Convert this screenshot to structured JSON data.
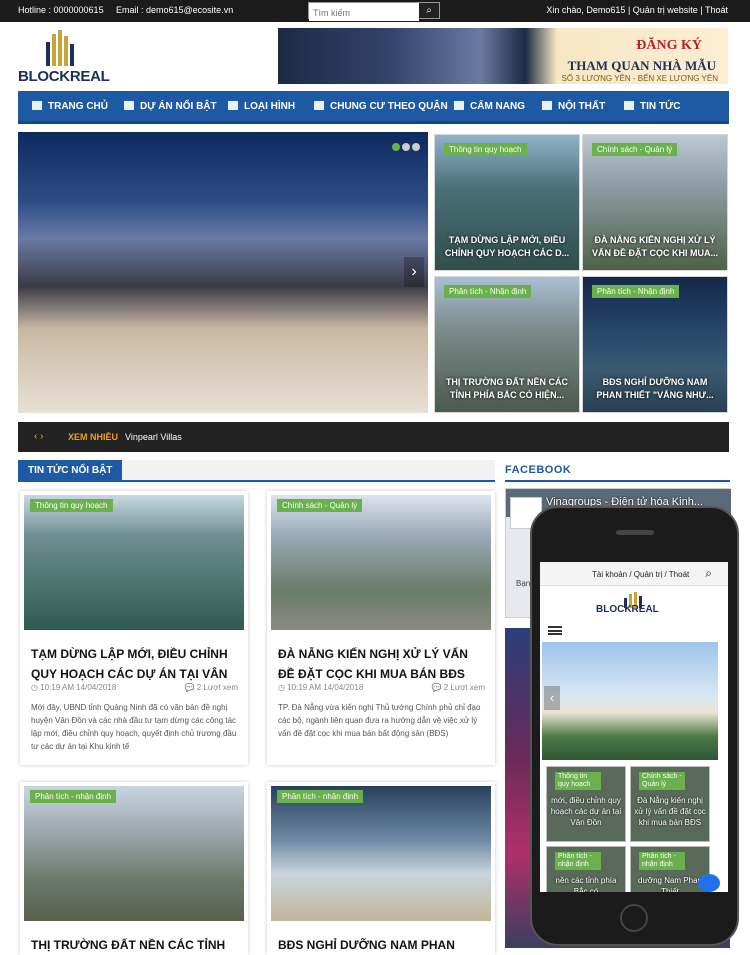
{
  "topbar": {
    "hotline": "Hotline : 0000000615",
    "email": "Email : demo615@ecosite.vn",
    "search_placeholder": "Tìm kiếm",
    "greeting": "Xin chào, Demo615 | Quản trị website | Thoát"
  },
  "logo": {
    "text": "BLOCKREAL"
  },
  "banner": {
    "line1": "ĐĂNG KÝ",
    "line2": "THAM QUAN NHÀ MẪU",
    "line3": "SỐ 3 LƯƠNG YÊN - BẾN XE LƯƠNG YÊN"
  },
  "nav": [
    {
      "label": "TRANG CHỦ",
      "icon": "home-icon"
    },
    {
      "label": "DỰ ÁN NỔI BẬT",
      "icon": "send-icon"
    },
    {
      "label": "LOẠI HÌNH",
      "icon": "image-icon"
    },
    {
      "label": "CHUNG CƯ THEO QUẬN",
      "icon": "briefcase-icon"
    },
    {
      "label": "CẨM NANG",
      "icon": "building-icon"
    },
    {
      "label": "NỘI THẤT",
      "icon": "book-icon"
    },
    {
      "label": "TIN TỨC",
      "icon": "newspaper-icon"
    }
  ],
  "hero_tiles": [
    {
      "tag": "Thông tin quy hoạch",
      "title": "TẠM DỪNG LẬP MỚI, ĐIỀU CHỈNH QUY HOẠCH CÁC D..."
    },
    {
      "tag": "Chính sách - Quản lý",
      "title": "ĐÀ NẴNG KIẾN NGHỊ XỬ LÝ VẤN ĐỀ ĐẶT CỌC KHI MUA..."
    },
    {
      "tag": "Phân tích - Nhận định",
      "title": "THỊ TRƯỜNG ĐẤT NỀN CÁC TỈNH PHÍA BẮC CÓ HIỆN..."
    },
    {
      "tag": "Phân tích - Nhận định",
      "title": "BĐS NGHỈ DƯỠNG NAM PHAN THIẾT \"VẮNG NHƯ..."
    }
  ],
  "ticker": {
    "label": "XEM NHIỀU",
    "value": "Vinpearl Villas"
  },
  "sections": {
    "featured": "TIN TỨC NỔI BẬT",
    "facebook": "FACEBOOK"
  },
  "cards": [
    {
      "tag": "Thông tin quy hoạch",
      "title": "TẠM DỪNG LẬP MỚI, ĐIỀU CHỈNH QUY HOẠCH CÁC DỰ ÁN TẠI VÂN",
      "date": "10:19 AM 14/04/2018",
      "views": "2 Lượt xem",
      "excerpt": "Mới đây, UBND tỉnh Quảng Ninh đã có văn bản đề nghị huyện Vân Đồn và các nhà đầu tư tạm dừng các công tác lập mới, điều chỉnh quy hoạch, quyết định chủ trương đầu tư các dự án tại Khu kinh tế"
    },
    {
      "tag": "Chính sách - Quản lý",
      "title": "ĐÀ NẴNG KIẾN NGHỊ XỬ LÝ VẤN ĐỀ ĐẶT CỌC KHI MUA BÁN BĐS",
      "date": "10:19 AM 14/04/2018",
      "views": "2 Lượt xem",
      "excerpt": "TP. Đà Nẵng vừa kiến nghị Thủ tướng Chính phủ chỉ đạo các bộ, ngành liên quan đưa ra hướng dẫn về việc xử lý vấn đề đặt cọc khi mua bán bất động sản (BĐS)"
    },
    {
      "tag": "Phân tích - nhận định",
      "title": "THỊ TRƯỜNG ĐẤT NỀN CÁC TỈNH"
    },
    {
      "tag": "Phân tích - nhận định",
      "title": "BĐS NGHỈ DƯỠNG NAM PHAN THIẾT"
    }
  ],
  "facebook_widget": {
    "page_name": "Vinagroups - Điện tử hóa Kinh...",
    "snippet": "Bạn"
  },
  "phone": {
    "topbar": "Tài khoản / Quản trị / Thoát",
    "logo": "BLOCKREAL",
    "tiles": [
      {
        "tag": "Thông tin quy hoạch",
        "title": "mới, điều chỉnh quy hoạch các dự án tại Vân Đồn"
      },
      {
        "tag": "Chính sách - Quản lý",
        "title": "Đà Nẵng kiến nghị xử lý vấn đề đặt cọc khi mua bán BĐS"
      },
      {
        "tag": "Phân tích - nhận định",
        "title": "nền các tỉnh phía Bắc có"
      },
      {
        "tag": "Phân tích - nhận định",
        "title": "dưỡng Nam Phan Thiết"
      }
    ]
  },
  "colors": {
    "nav": "#1e5aa3",
    "tag": "#6ab04c",
    "topbar": "#1b1b1b"
  }
}
